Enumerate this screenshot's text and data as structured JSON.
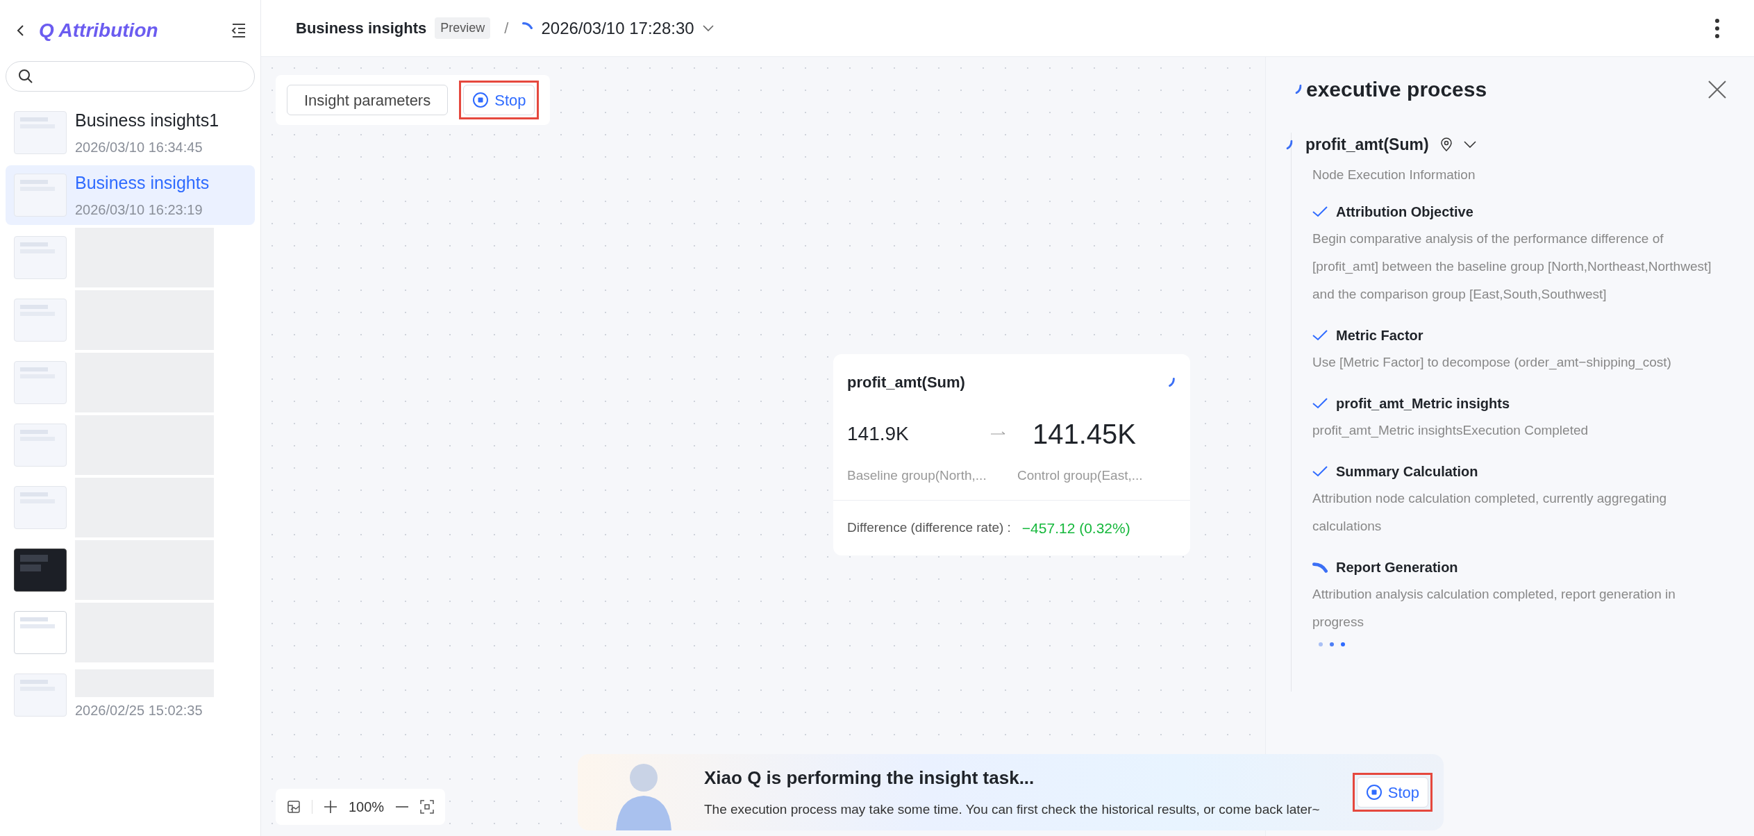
{
  "sidebar": {
    "brand": "Q Attribution",
    "items": [
      {
        "title": "Business insights1",
        "time": "2026/03/10 16:34:45",
        "selected": false,
        "blurred": false,
        "kind": "light"
      },
      {
        "title": "Business insights",
        "time": "2026/03/10 16:23:19",
        "selected": true,
        "blurred": false,
        "kind": "light"
      },
      {
        "selected": false,
        "blurred": true,
        "kind": "light"
      },
      {
        "selected": false,
        "blurred": true,
        "kind": "light"
      },
      {
        "selected": false,
        "blurred": true,
        "kind": "light"
      },
      {
        "selected": false,
        "blurred": true,
        "kind": "light"
      },
      {
        "selected": false,
        "blurred": true,
        "kind": "light"
      },
      {
        "selected": false,
        "blurred": true,
        "kind": "dark"
      },
      {
        "selected": false,
        "blurred": true,
        "kind": "blank"
      },
      {
        "time": "2026/02/25 15:02:35",
        "selected": false,
        "blurred": true,
        "kind": "light"
      }
    ]
  },
  "header": {
    "title": "Business insights",
    "badge": "Preview",
    "separator": "/",
    "run_time": "2026/03/10 17:28:30"
  },
  "toolbar": {
    "params_button": "Insight parameters",
    "stop_button": "Stop",
    "highlighted": true
  },
  "node": {
    "title": "profit_amt(Sum)",
    "baseline_value": "141.9K",
    "control_value": "141.45K",
    "baseline_label": "Baseline group(North,...",
    "control_label": "Control group(East,...",
    "difference_label": "Difference (difference rate) :",
    "difference_value": "−457.12 (0.32%)"
  },
  "zoom": {
    "level": "100%"
  },
  "panel": {
    "title": "executive process",
    "node_title": "profit_amt(Sum)",
    "node_subtitle": "Node Execution Information",
    "steps": [
      {
        "kind": "done",
        "title": "Attribution Objective",
        "text": "Begin comparative analysis of the performance difference of [profit_amt] between the baseline group [North,Northeast,Northwest] and the comparison group [East,South,Southwest]"
      },
      {
        "kind": "done",
        "title": "Metric Factor",
        "text": "Use [Metric Factor] to decompose (order_amt−shipping_cost)"
      },
      {
        "kind": "done",
        "title": "profit_amt_Metric insights",
        "text": "profit_amt_Metric insightsExecution Completed"
      },
      {
        "kind": "done",
        "title": "Summary Calculation",
        "text": "Attribution node calculation completed, currently aggregating calculations"
      },
      {
        "kind": "running",
        "title": "Report Generation",
        "text": "Attribution analysis calculation completed, report generation in progress"
      }
    ]
  },
  "banner": {
    "title": "Xiao Q is performing the insight task...",
    "text": "The execution process may take some time. You can first check the historical results, or come back later~",
    "stop_button": "Stop",
    "highlighted": true
  }
}
